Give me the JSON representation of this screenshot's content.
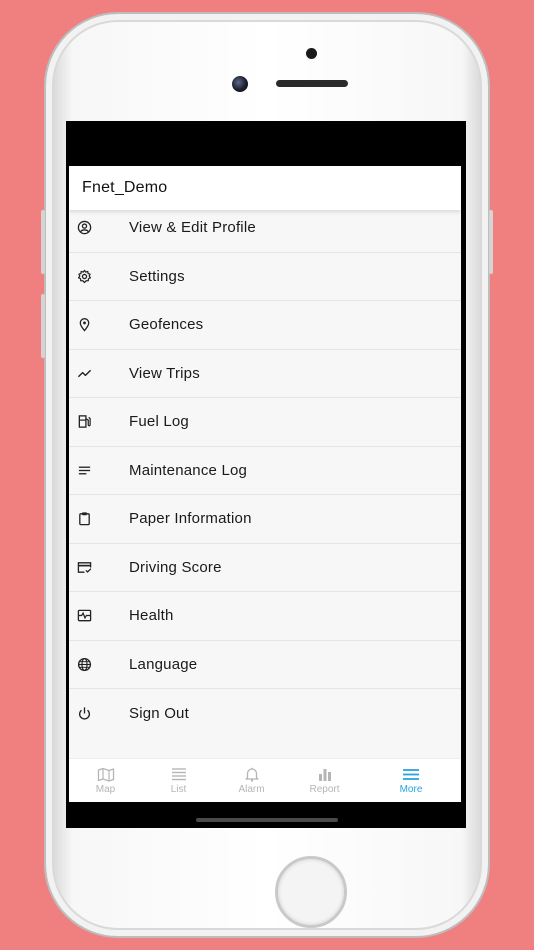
{
  "app": {
    "title": "Fnet_Demo"
  },
  "menu": {
    "items": [
      {
        "label": "View & Edit Profile",
        "icon": "profile-icon"
      },
      {
        "label": "Settings",
        "icon": "gear-icon"
      },
      {
        "label": "Geofences",
        "icon": "location-pin-icon"
      },
      {
        "label": "View Trips",
        "icon": "trending-icon"
      },
      {
        "label": "Fuel Log",
        "icon": "fuel-pump-icon"
      },
      {
        "label": "Maintenance Log",
        "icon": "notes-icon"
      },
      {
        "label": "Paper Information",
        "icon": "clipboard-icon"
      },
      {
        "label": "Driving Score",
        "icon": "card-check-icon"
      },
      {
        "label": "Health",
        "icon": "health-monitor-icon"
      },
      {
        "label": "Language",
        "icon": "globe-icon"
      },
      {
        "label": "Sign Out",
        "icon": "power-icon"
      }
    ]
  },
  "tabs": [
    {
      "label": "Map",
      "icon": "map-icon",
      "active": false
    },
    {
      "label": "List",
      "icon": "list-icon",
      "active": false
    },
    {
      "label": "Alarm",
      "icon": "bell-icon",
      "active": false
    },
    {
      "label": "Report",
      "icon": "bar-chart-icon",
      "active": false
    },
    {
      "label": "More",
      "icon": "menu-icon",
      "active": true
    }
  ],
  "colors": {
    "background": "#f08080",
    "accent": "#29a3e0",
    "inactive_tab": "#b5b5b5"
  }
}
